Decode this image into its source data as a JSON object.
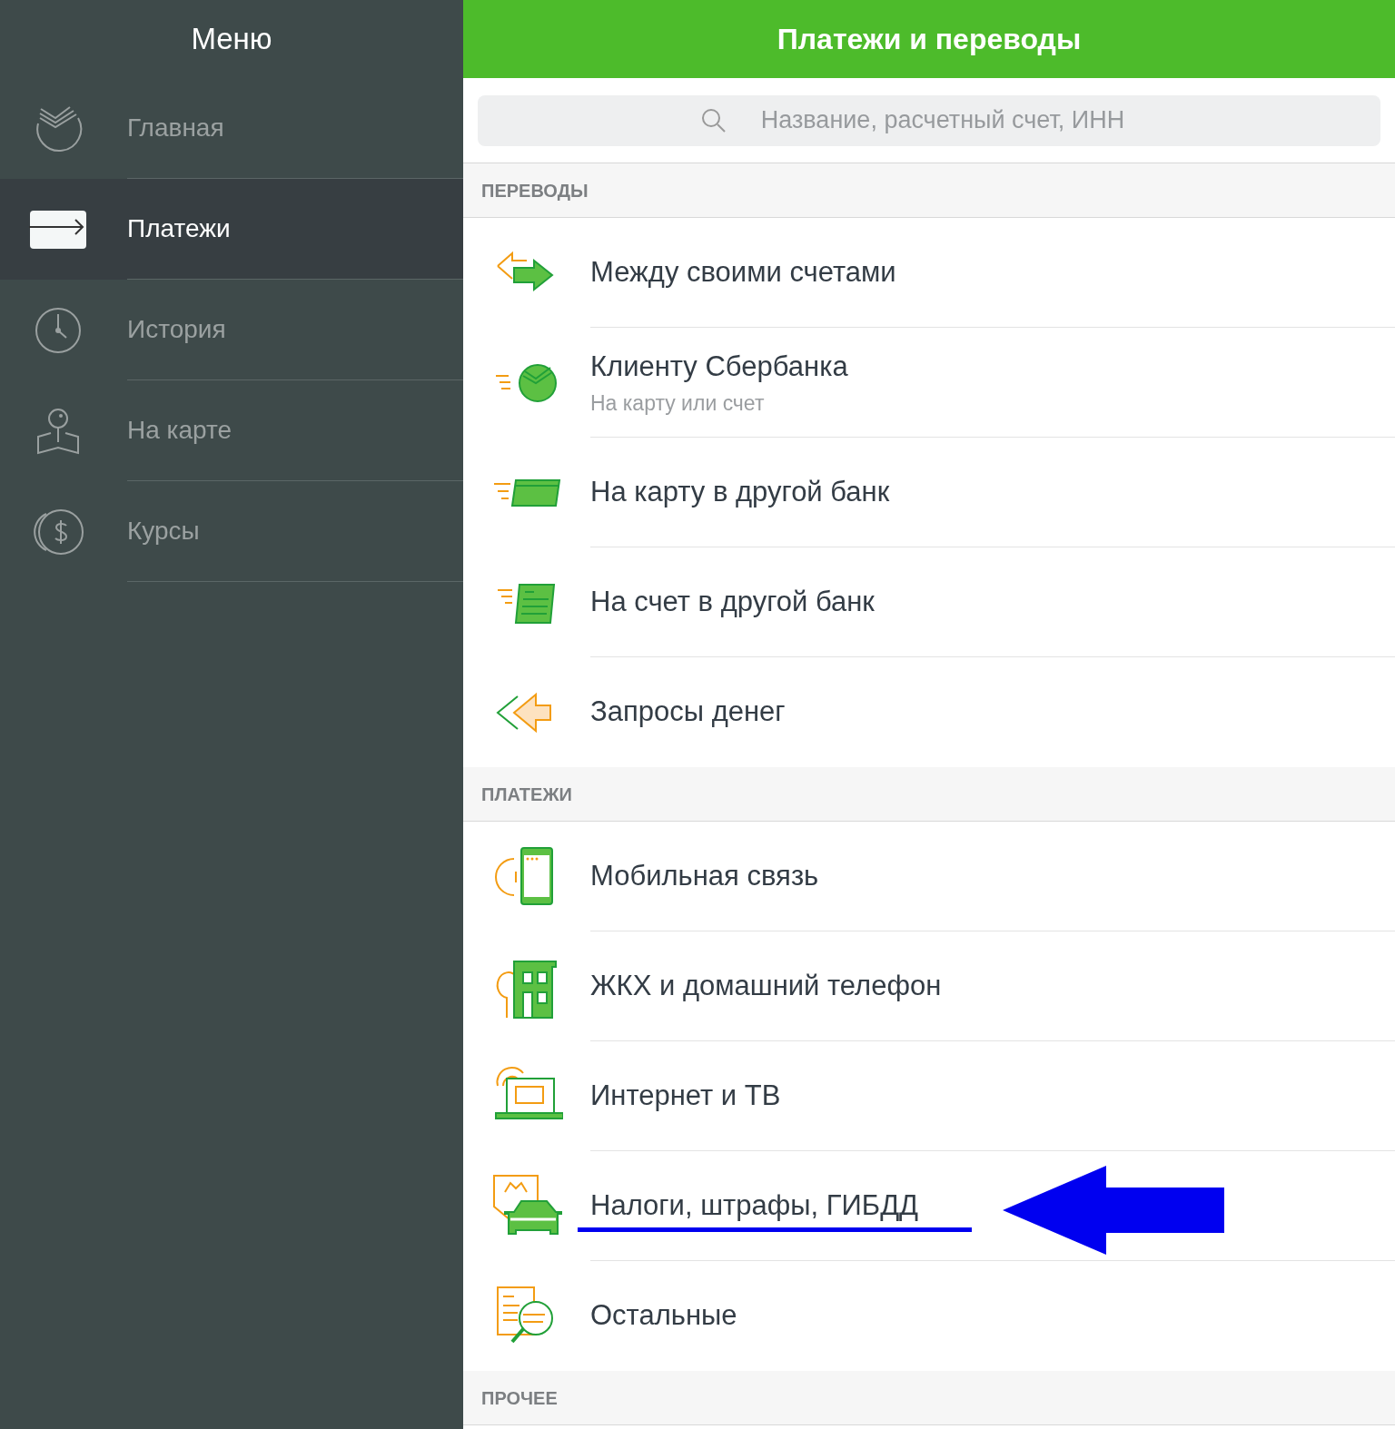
{
  "sidebar": {
    "title": "Меню",
    "items": [
      {
        "kind": "home",
        "label": "Главная",
        "selected": false
      },
      {
        "kind": "payments",
        "label": "Платежи",
        "selected": true
      },
      {
        "kind": "history",
        "label": "История",
        "selected": false
      },
      {
        "kind": "map",
        "label": "На карте",
        "selected": false
      },
      {
        "kind": "rates",
        "label": "Курсы",
        "selected": false
      }
    ]
  },
  "header": {
    "title": "Платежи и переводы"
  },
  "search": {
    "placeholder": "Название, расчетный счет, ИНН"
  },
  "sections": [
    {
      "title": "ПЕРЕВОДЫ",
      "items": [
        {
          "kind": "exchange",
          "title": "Между своими счетами",
          "highlighted": false
        },
        {
          "kind": "sber",
          "title": "Клиенту Сбербанка",
          "subtitle": "На карту или счет",
          "highlighted": false
        },
        {
          "kind": "card",
          "title": "На карту в другой банк",
          "highlighted": false
        },
        {
          "kind": "account",
          "title": "На счет в другой банк",
          "highlighted": false
        },
        {
          "kind": "request",
          "title": "Запросы денег",
          "highlighted": false
        }
      ]
    },
    {
      "title": "ПЛАТЕЖИ",
      "items": [
        {
          "kind": "mobile",
          "title": "Мобильная связь",
          "highlighted": false
        },
        {
          "kind": "utilities",
          "title": "ЖКХ и домашний телефон",
          "highlighted": false
        },
        {
          "kind": "internet",
          "title": "Интернет и ТВ",
          "highlighted": false
        },
        {
          "kind": "fines",
          "title": "Налоги, штрафы, ГИБДД",
          "highlighted": true
        },
        {
          "kind": "other",
          "title": "Остальные",
          "highlighted": false
        }
      ]
    },
    {
      "title": "ПРОЧЕЕ"
    }
  ]
}
